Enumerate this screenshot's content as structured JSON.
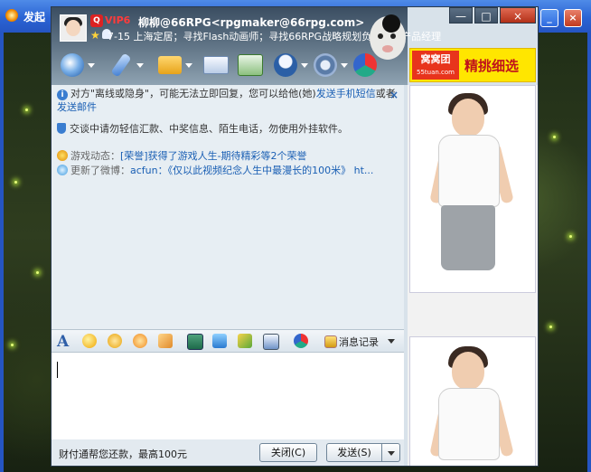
{
  "background_window": {
    "title": "发起",
    "buttons": [
      "_",
      "□",
      "×"
    ]
  },
  "chat_window": {
    "vip_label": "VIP6",
    "contact_name": "柳柳@66RPG<rpgmaker@66rpg.com>",
    "status_line": "7-15 上海定居；寻找Flash动画师；寻找66RPG战略规划负责人、产品经理",
    "window_buttons": [
      "—",
      "□",
      "×"
    ],
    "toolbar_icons": [
      "video-call-icon",
      "voice-call-icon",
      "file-transfer-icon",
      "mail-icon",
      "add-contact-icon",
      "user-manage-icon",
      "settings-icon",
      "payment-icon"
    ],
    "ad": {
      "logo": "窝窝团",
      "logo_url": "55tuan.com",
      "text": "精挑细选"
    },
    "notice": {
      "text_before": "对方\"离线或隐身\"，可能无法立即回复，您可以给他(她)",
      "link1": "发送手机短信",
      "text_mid": "或者",
      "link2": "发送邮件"
    },
    "warning": "交谈中请勿轻信汇款、中奖信息、陌生电话，勿使用外挂软件。",
    "feeds": [
      {
        "label": "游戏动态：",
        "content": "[荣誉]获得了游戏人生-期待精彩等2个荣誉"
      },
      {
        "label": "更新了微博：",
        "content": "acfun：《仅以此视频纪念人生中最漫长的100米》 ht..."
      }
    ],
    "format_bar": {
      "msg_record": "消息记录"
    },
    "footer": {
      "text": "财付通帮您还款，最高100元",
      "close": "关闭(C)",
      "send": "发送(S)"
    }
  }
}
